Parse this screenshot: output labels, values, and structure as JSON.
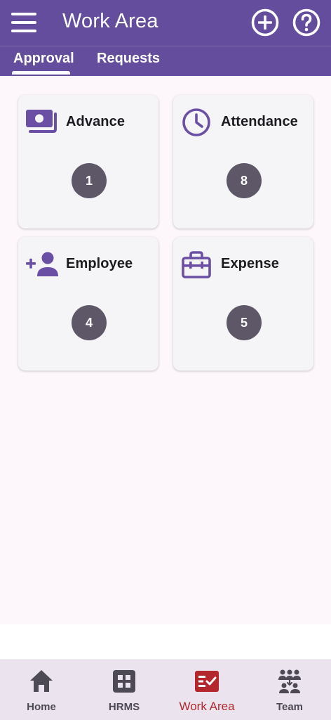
{
  "header": {
    "title": "Work Area",
    "add_icon": "plus-circle-icon",
    "help_icon": "help-circle-icon",
    "menu_icon": "hamburger-menu-icon"
  },
  "tabs": [
    {
      "label": "Approval",
      "active": true
    },
    {
      "label": "Requests",
      "active": false
    }
  ],
  "cards": [
    {
      "label": "Advance",
      "count": "1",
      "icon": "money-stack-icon"
    },
    {
      "label": "Attendance",
      "count": "8",
      "icon": "clock-icon"
    },
    {
      "label": "Employee",
      "count": "4",
      "icon": "add-person-icon"
    },
    {
      "label": "Expense",
      "count": "5",
      "icon": "briefcase-icon"
    }
  ],
  "bottom_nav": [
    {
      "label": "Home",
      "icon": "home-icon",
      "active": false
    },
    {
      "label": "HRMS",
      "icon": "grid-icon",
      "active": false
    },
    {
      "label": "Work Area",
      "icon": "checklist-icon",
      "active": true
    },
    {
      "label": "Team",
      "icon": "team-icon",
      "active": false
    }
  ],
  "colors": {
    "primary": "#654d9d",
    "accent_icon": "#6a4fa5",
    "badge": "#5d5767",
    "active_nav": "#b3272d",
    "background": "#fdf7fc"
  }
}
